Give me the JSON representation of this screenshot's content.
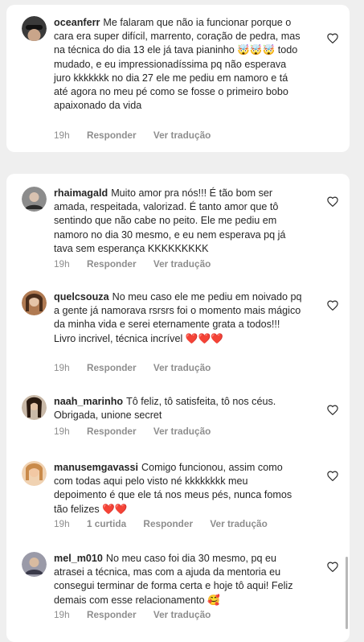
{
  "comments": [
    {
      "username": "oceanferr",
      "text": "Me falaram que não ia funcionar porque o cara era super difícil, marrento, coração de pedra, mas na técnica do dia 13 ele já tava pianinho 🤯🤯🤯 todo mudado, e eu impressionadíssima pq não esperava juro kkkkkkk no dia 27 ele me pediu em namoro e tá até agora no meu pé como se fosse o primeiro bobo apaixonado da vida",
      "time": "19h",
      "reply": "Responder",
      "translate": "Ver tradução",
      "avatar_color": "#3a3a3a"
    },
    {
      "username": "rhaimagald",
      "text": "Muito amor pra nós!!! É tão bom ser amada, respeitada, valorizad. É tanto amor que tô sentindo que não cabe no peito. Ele me pediu em namoro no dia 30 mesmo, e eu nem esperava pq já tava sem esperança KKKKKKKKK",
      "time": "19h",
      "reply": "Responder",
      "translate": "Ver tradução",
      "avatar_color": "#6b6b6b"
    },
    {
      "username": "quelcsouza",
      "text": "No meu caso ele me pediu em noivado pq a gente já namorava rsrsrs foi o momento mais mágico da minha vida e serei eternamente grata a todos!!! Livro incrivel, técnica incrível ❤️❤️❤️",
      "time": "19h",
      "reply": "Responder",
      "translate": "Ver tradução",
      "avatar_color": "#8a5a3a"
    },
    {
      "username": "naah_marinho",
      "text": "Tô feliz, tô satisfeita, tô nos céus. Obrigada, unione secret",
      "time": "19h",
      "reply": "Responder",
      "translate": "Ver tradução",
      "avatar_color": "#5a4030"
    },
    {
      "username": "manusemgavassi",
      "text": "Comigo funcionou, assim como com todas aqui pelo visto né kkkkkkkk meu depoimento é que ele tá nos meus pés, nunca fomos tão felizes ❤️❤️",
      "time": "19h",
      "likes": "1 curtida",
      "reply": "Responder",
      "translate": "Ver tradução",
      "avatar_color": "#d89a6a"
    },
    {
      "username": "mel_m010",
      "text": "No meu caso foi dia 30 mesmo, pq eu atrasei a técnica, mas com a ajuda da mentoria eu consegui terminar de forma certa e hoje tô aqui! Feliz demais com esse relacionamento 🥰",
      "time": "19h",
      "reply": "Responder",
      "translate": "Ver tradução",
      "avatar_color": "#7a7a8a"
    }
  ]
}
